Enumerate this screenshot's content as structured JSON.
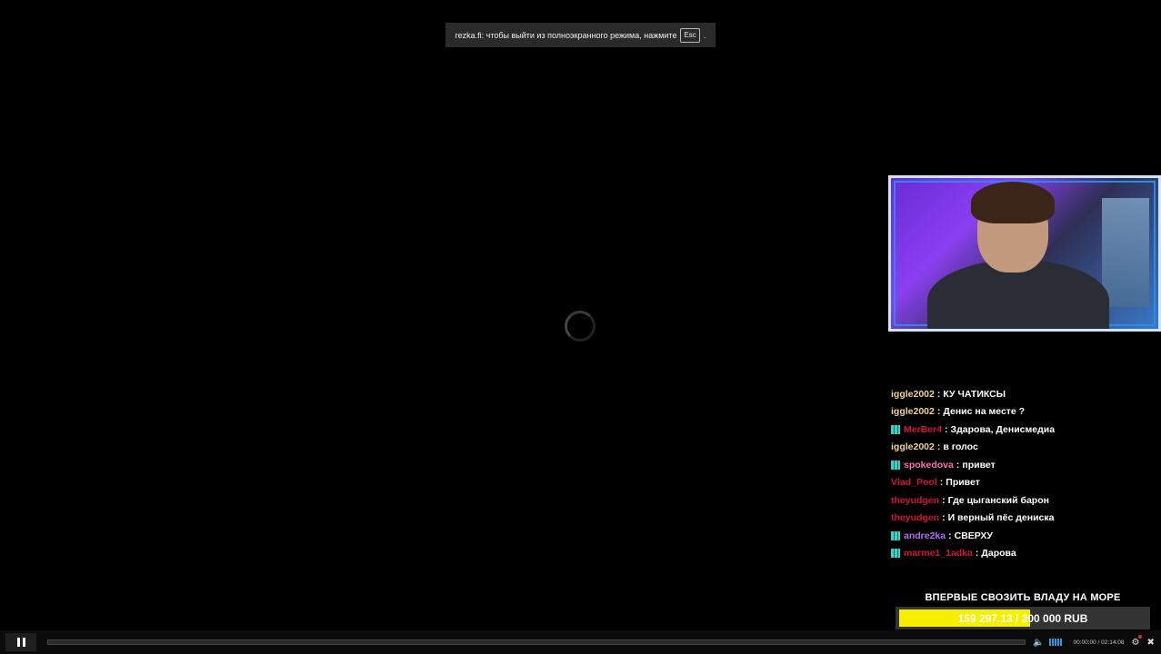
{
  "fullscreen_notice": {
    "text": "rezka.fi: чтобы выйти из полноэкранного режима, нажмите",
    "key": "Esc",
    "suffix": "."
  },
  "chat": [
    {
      "user": "iggle2002",
      "sep": ":",
      "msg": "КУ ЧАТИКСЫ",
      "color": "gold",
      "badge": false
    },
    {
      "user": "iggle2002",
      "sep": ":",
      "msg": "Денис на месте ?",
      "color": "gold",
      "badge": false
    },
    {
      "user": "MerBer4",
      "sep": ":",
      "msg": "Здарова, Денисмедиа",
      "color": "red",
      "badge": true
    },
    {
      "user": "iggle2002",
      "sep": ":",
      "msg": "в голос",
      "color": "gold",
      "badge": false
    },
    {
      "user": "spokedova",
      "sep": ":",
      "msg": "привет",
      "color": "pink",
      "badge": true
    },
    {
      "user": "Vlad_Pool",
      "sep": ":",
      "msg": "Привет",
      "color": "red",
      "badge": false
    },
    {
      "user": "theyudgen",
      "sep": ":",
      "msg": "Где цыганский барон",
      "color": "red",
      "badge": false
    },
    {
      "user": "theyudgen",
      "sep": ":",
      "msg": "И верный пёс дениска",
      "color": "red",
      "badge": false
    },
    {
      "user": "andre2ka",
      "sep": ":",
      "msg": "СВЕРХУ",
      "color": "purple",
      "badge": true
    },
    {
      "user": "marme1_1adka",
      "sep": ":",
      "msg": "Дарова",
      "color": "red",
      "badge": true
    }
  ],
  "donation": {
    "title": "ВПЕРВЫЕ СВОЗИТЬ ВЛАДУ НА МОРЕ",
    "amount": "159 297.13 / 300 000 RUB",
    "progress": 0.531,
    "fill_color": "#f6f000"
  },
  "player": {
    "time": "00:00:00 / 02:14:08",
    "progress": 0,
    "icons": [
      "pause-icon",
      "volume-icon",
      "settings-icon",
      "fullscreen-exit-icon"
    ]
  }
}
